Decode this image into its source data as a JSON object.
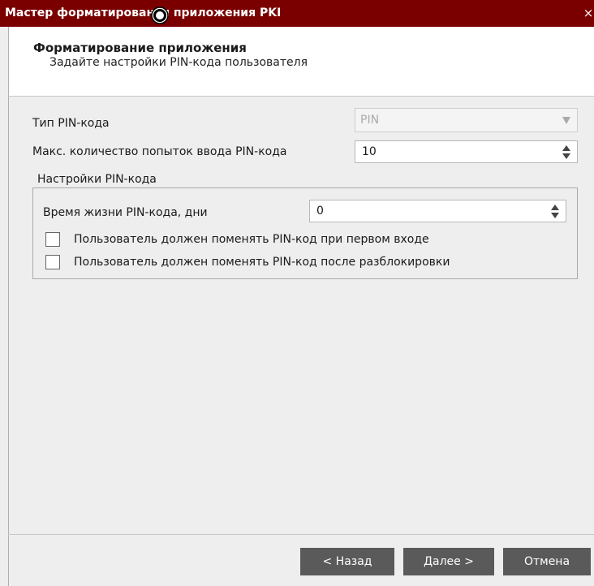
{
  "window": {
    "title": "Мастер форматирования приложения PKI",
    "close_glyph": "×"
  },
  "header": {
    "title": "Форматирование приложения",
    "subtitle": "Задайте настройки PIN-кода пользователя"
  },
  "form": {
    "pin_type": {
      "label": "Тип PIN-кода",
      "value": "PIN",
      "disabled": true
    },
    "max_attempts": {
      "label": "Макс. количество попыток ввода PIN-кода",
      "value": "10"
    },
    "pin_settings_group": {
      "title": "Настройки PIN-кода",
      "lifetime": {
        "label": "Время жизни PIN-кода, дни",
        "value": "0"
      },
      "change_on_first_login": {
        "label": "Пользователь должен поменять PIN-код при первом входе",
        "checked": false
      },
      "change_after_unblock": {
        "label": "Пользователь должен поменять PIN-код после разблокировки",
        "checked": false
      }
    }
  },
  "buttons": {
    "back": "< Назад",
    "next": "Далее >",
    "cancel": "Отмена"
  },
  "colors": {
    "titlebar": "#7a0000",
    "button": "#5a5a5a",
    "dialog_bg": "#eeeeee"
  },
  "icons": {
    "cursor": "mouse-cursor-busy-icon",
    "dropdown": "chevron-down-icon",
    "spinner": "spinner-arrows-icon"
  }
}
